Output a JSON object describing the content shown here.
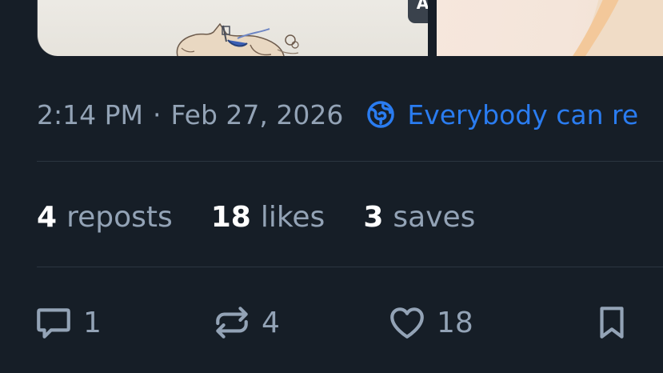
{
  "images": {
    "alt_badge_label": "ALT"
  },
  "post_meta": {
    "time": "2:14 PM",
    "separator": "·",
    "date": "Feb 27, 2026",
    "audience_label": "Everybody can re"
  },
  "stats": [
    {
      "value": "4",
      "label": "reposts"
    },
    {
      "value": "18",
      "label": "likes"
    },
    {
      "value": "3",
      "label": "saves"
    }
  ],
  "actions": {
    "reply_count": "1",
    "repost_count": "4",
    "like_count": "18"
  },
  "colors": {
    "background": "#161e27",
    "muted_text": "#93a3b6",
    "accent": "#2a7cf0",
    "divider": "#2b3540"
  }
}
